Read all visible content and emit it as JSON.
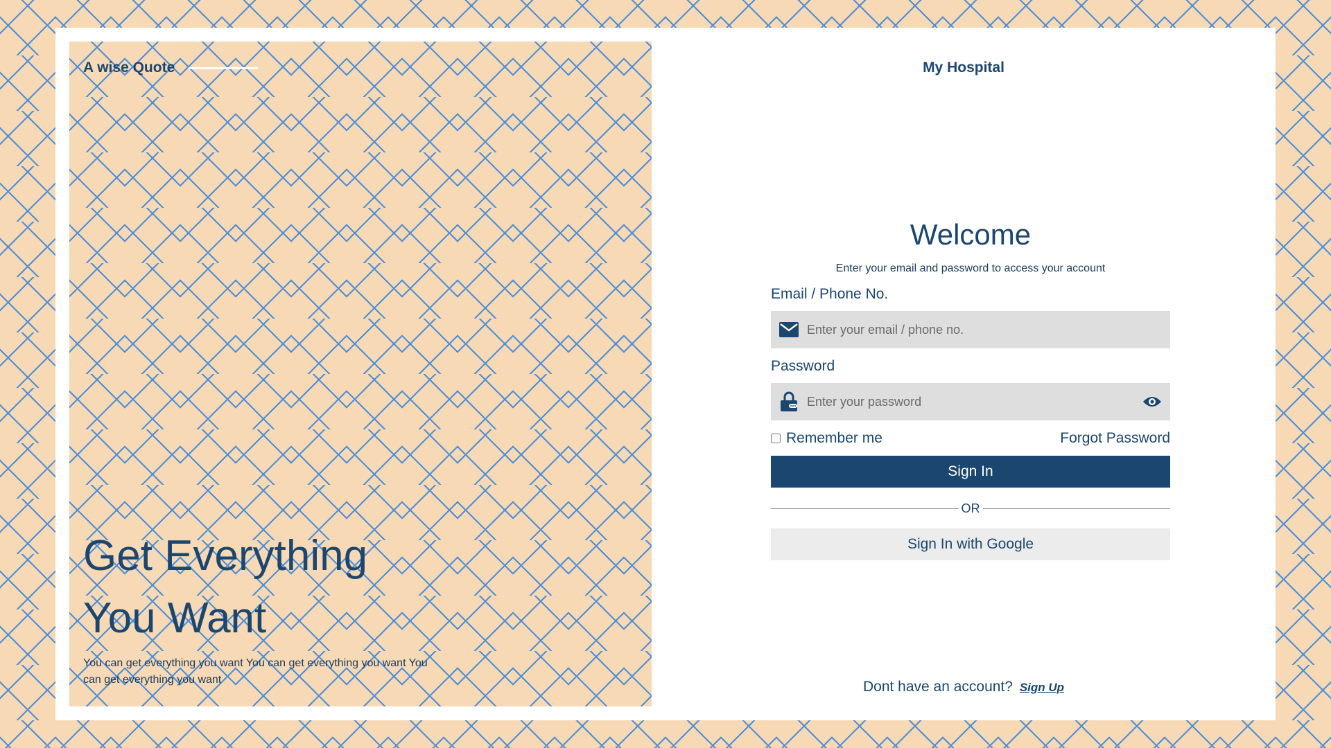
{
  "left": {
    "quote_label": "A wise Quote",
    "hero_line1": "Get Everything",
    "hero_line2": "You Want",
    "hero_sub": "You can get everything you want You can get everything you want You can get everything you want"
  },
  "right": {
    "brand": "My Hospital",
    "welcome_title": "Welcome",
    "welcome_sub": "Enter your email and password to access your account",
    "email_label": "Email / Phone No.",
    "email_placeholder": "Enter your email / phone no.",
    "password_label": "Password",
    "password_placeholder": "Enter your password",
    "remember_label": "Remember me",
    "remember_checked": false,
    "forgot_label": "Forgot Password",
    "sign_in_label": "Sign In",
    "or_label": "OR",
    "google_label": "Sign In with Google",
    "no_account_text": "Dont have an account?",
    "sign_up_label": "Sign Up"
  },
  "icons": {
    "email": "envelope-icon",
    "password": "lock-icon",
    "toggle_visibility": "eye-icon"
  },
  "colors": {
    "primary": "#1b466f",
    "background": "#f8d9b5",
    "pattern_line": "#4f8fd6",
    "input_bg": "#dedede"
  }
}
